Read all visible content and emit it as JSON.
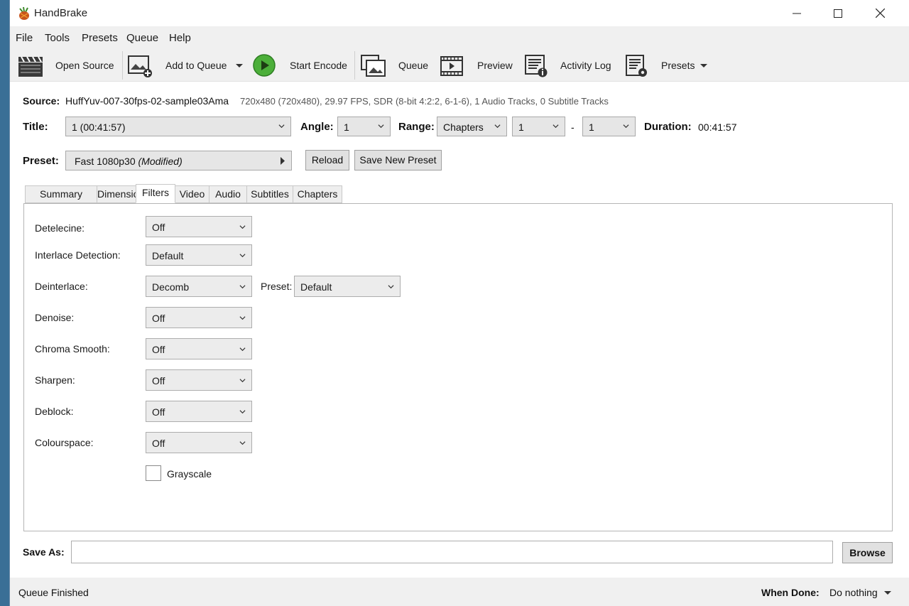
{
  "window": {
    "title": "HandBrake"
  },
  "menu": [
    "File",
    "Tools",
    "Presets",
    "Queue",
    "Help"
  ],
  "toolbar": {
    "open_source": "Open Source",
    "add_to_queue": "Add to Queue",
    "start_encode": "Start Encode",
    "queue": "Queue",
    "preview": "Preview",
    "activity_log": "Activity Log",
    "presets": "Presets"
  },
  "source": {
    "label": "Source:",
    "name": "HuffYuv-007-30fps-02-sample03Ama",
    "info": "720x480 (720x480), 29.97 FPS, SDR (8-bit 4:2:2, 6-1-6), 1 Audio Tracks, 0 Subtitle Tracks"
  },
  "title_row": {
    "title_label": "Title:",
    "title_value": "1  (00:41:57)",
    "angle_label": "Angle:",
    "angle_value": "1",
    "range_label": "Range:",
    "range_type": "Chapters",
    "range_start": "1",
    "range_dash": "-",
    "range_end": "1",
    "duration_label": "Duration:",
    "duration_value": "00:41:57"
  },
  "preset_row": {
    "label": "Preset:",
    "name": "Fast 1080p30",
    "modified": "(Modified)",
    "reload": "Reload",
    "save_new": "Save New Preset"
  },
  "tabs": [
    "Summary",
    "Dimensions",
    "Filters",
    "Video",
    "Audio",
    "Subtitles",
    "Chapters"
  ],
  "active_tab": "Filters",
  "filters": {
    "detelecine": {
      "label": "Detelecine:",
      "value": "Off"
    },
    "interlace_detection": {
      "label": "Interlace Detection:",
      "value": "Default"
    },
    "deinterlace": {
      "label": "Deinterlace:",
      "value": "Decomb",
      "preset_label": "Preset:",
      "preset_value": "Default"
    },
    "denoise": {
      "label": "Denoise:",
      "value": "Off"
    },
    "chroma_smooth": {
      "label": "Chroma Smooth:",
      "value": "Off"
    },
    "sharpen": {
      "label": "Sharpen:",
      "value": "Off"
    },
    "deblock": {
      "label": "Deblock:",
      "value": "Off"
    },
    "colourspace": {
      "label": "Colourspace:",
      "value": "Off"
    },
    "grayscale": {
      "label": "Grayscale",
      "checked": false
    }
  },
  "save_as": {
    "label": "Save As:",
    "value": "",
    "browse": "Browse"
  },
  "status": {
    "text": "Queue Finished",
    "when_done_label": "When Done:",
    "when_done_value": "Do nothing"
  },
  "colors": {
    "play_green": "#4caf3a",
    "window_bg": "#ffffff",
    "bar_bg": "#f0f0f0"
  }
}
